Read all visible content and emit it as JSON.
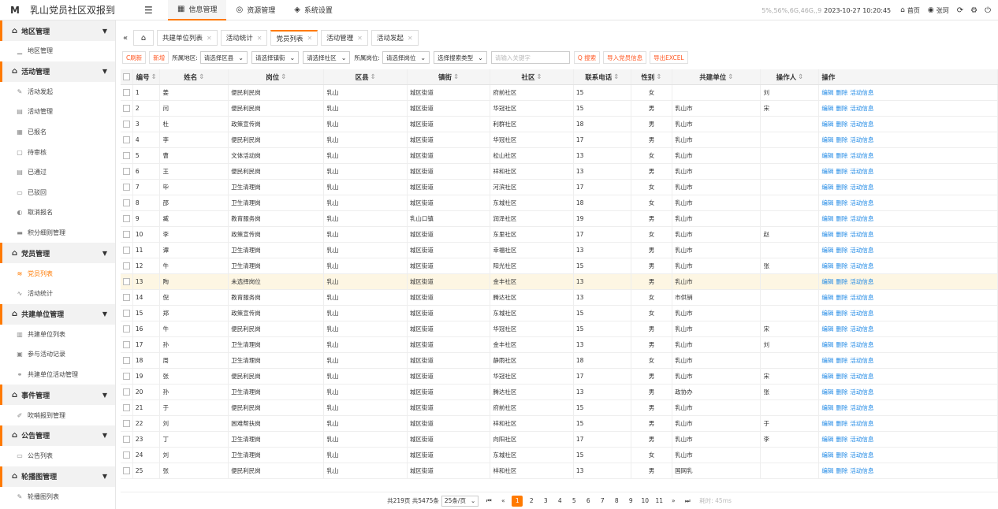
{
  "app": {
    "logo": "M",
    "title": "乳山党员社区双报到",
    "burger": "☰"
  },
  "topnav": [
    {
      "icon": "▦",
      "label": "信息管理",
      "active": true
    },
    {
      "icon": "◎",
      "label": "资源管理",
      "active": false
    },
    {
      "icon": "◈",
      "label": "系统设置",
      "active": false
    }
  ],
  "topright": {
    "stats": "5%,56%,6G,46G,,9",
    "datetime": "2023-10-27 10:20:45",
    "home": "首页",
    "user": "张珂"
  },
  "sidebar": [
    {
      "type": "group",
      "label": "地区管理",
      "icon": "⌂"
    },
    {
      "type": "item",
      "label": "地区管理",
      "icon": "▁"
    },
    {
      "type": "group",
      "label": "活动管理",
      "icon": "⌂"
    },
    {
      "type": "item",
      "label": "活动发起",
      "icon": "✎"
    },
    {
      "type": "item",
      "label": "活动管理",
      "icon": "▤"
    },
    {
      "type": "item",
      "label": "已报名",
      "icon": "▦"
    },
    {
      "type": "item",
      "label": "待审核",
      "icon": "▢"
    },
    {
      "type": "item",
      "label": "已通过",
      "icon": "▤"
    },
    {
      "type": "item",
      "label": "已驳回",
      "icon": "▭"
    },
    {
      "type": "item",
      "label": "取消报名",
      "icon": "◐"
    },
    {
      "type": "item",
      "label": "积分细则管理",
      "icon": "▬"
    },
    {
      "type": "group",
      "label": "党员管理",
      "icon": "⌂"
    },
    {
      "type": "item",
      "label": "党员列表",
      "icon": "≋",
      "active": true
    },
    {
      "type": "item",
      "label": "活动统计",
      "icon": "∿"
    },
    {
      "type": "group",
      "label": "共建单位管理",
      "icon": "⌂"
    },
    {
      "type": "item",
      "label": "共建单位列表",
      "icon": "▥"
    },
    {
      "type": "item",
      "label": "参与活动记录",
      "icon": "▣"
    },
    {
      "type": "item",
      "label": "共建单位活动管理",
      "icon": "⚭"
    },
    {
      "type": "group",
      "label": "事件管理",
      "icon": "⌂"
    },
    {
      "type": "item",
      "label": "吹哨报到管理",
      "icon": "✐"
    },
    {
      "type": "group",
      "label": "公告管理",
      "icon": "⌂"
    },
    {
      "type": "item",
      "label": "公告列表",
      "icon": "▭"
    },
    {
      "type": "group",
      "label": "轮播图管理",
      "icon": "⌂"
    },
    {
      "type": "item",
      "label": "轮播图列表",
      "icon": "✎"
    }
  ],
  "tabs": [
    {
      "label": "共建单位列表",
      "active": false
    },
    {
      "label": "活动统计",
      "active": false
    },
    {
      "label": "党员列表",
      "active": true
    },
    {
      "label": "活动管理",
      "active": false
    },
    {
      "label": "活动发起",
      "active": false
    }
  ],
  "toolbar": {
    "refresh": "C刷新",
    "add": "新增",
    "area_label": "所属地区:",
    "district_select": "请选择区县",
    "street_select": "请选择镇街",
    "community_select": "请选择社区",
    "post_label": "所属岗位:",
    "post_select": "请选择岗位",
    "search_type": "选择搜索类型",
    "keyword_placeholder": "请输入关键字",
    "search": "Q 搜索",
    "import": "导入党员信息",
    "export": "导出EXCEL"
  },
  "table": {
    "headers": {
      "no": "编号",
      "name": "姓名",
      "post": "岗位",
      "district": "区县",
      "street": "镇街",
      "community": "社区",
      "phone": "联系电话",
      "sex": "性别",
      "unit": "共建单位",
      "operator": "操作人",
      "action": "操作"
    },
    "actions": [
      "编辑",
      "删除",
      "活动信息"
    ],
    "rows": [
      {
        "no": "1",
        "name": "姜",
        "post": "便民利民岗",
        "district": "乳山",
        "street": "城区街道",
        "community": "府前社区",
        "phone": "15",
        "sex": "女",
        "unit": "",
        "operator": "刘"
      },
      {
        "no": "2",
        "name": "闫",
        "post": "便民利民岗",
        "district": "乳山",
        "street": "城区街道",
        "community": "华冠社区",
        "phone": "15",
        "sex": "男",
        "unit": "乳山市",
        "operator": "宋"
      },
      {
        "no": "3",
        "name": "杜",
        "post": "政策宣传岗",
        "district": "乳山",
        "street": "城区街道",
        "community": "利群社区",
        "phone": "18",
        "sex": "男",
        "unit": "乳山市",
        "operator": ""
      },
      {
        "no": "4",
        "name": "李",
        "post": "便民利民岗",
        "district": "乳山",
        "street": "城区街道",
        "community": "华冠社区",
        "phone": "17",
        "sex": "男",
        "unit": "乳山市",
        "operator": ""
      },
      {
        "no": "5",
        "name": "曹",
        "post": "文体活动岗",
        "district": "乳山",
        "street": "城区街道",
        "community": "松山社区",
        "phone": "13",
        "sex": "女",
        "unit": "乳山市",
        "operator": ""
      },
      {
        "no": "6",
        "name": "王",
        "post": "便民利民岗",
        "district": "乳山",
        "street": "城区街道",
        "community": "祥和社区",
        "phone": "13",
        "sex": "男",
        "unit": "乳山市",
        "operator": ""
      },
      {
        "no": "7",
        "name": "毕",
        "post": "卫生清理岗",
        "district": "乳山",
        "street": "城区街道",
        "community": "河滨社区",
        "phone": "17",
        "sex": "女",
        "unit": "乳山市",
        "operator": ""
      },
      {
        "no": "8",
        "name": "邵",
        "post": "卫生清理岗",
        "district": "乳山",
        "street": "城区街道",
        "community": "东城社区",
        "phone": "18",
        "sex": "女",
        "unit": "乳山市",
        "operator": ""
      },
      {
        "no": "9",
        "name": "臧",
        "post": "教育服务岗",
        "district": "乳山",
        "street": "乳山口镇",
        "community": "润泽社区",
        "phone": "19",
        "sex": "男",
        "unit": "乳山市",
        "operator": ""
      },
      {
        "no": "10",
        "name": "李",
        "post": "政策宣传岗",
        "district": "乳山",
        "street": "城区街道",
        "community": "东里社区",
        "phone": "17",
        "sex": "女",
        "unit": "乳山市",
        "operator": "赵"
      },
      {
        "no": "11",
        "name": "谭",
        "post": "卫生清理岗",
        "district": "乳山",
        "street": "城区街道",
        "community": "幸福社区",
        "phone": "13",
        "sex": "男",
        "unit": "乳山市",
        "operator": ""
      },
      {
        "no": "12",
        "name": "牛",
        "post": "卫生清理岗",
        "district": "乳山",
        "street": "城区街道",
        "community": "阳光社区",
        "phone": "15",
        "sex": "男",
        "unit": "乳山市",
        "operator": "张"
      },
      {
        "no": "13",
        "name": "陶",
        "post": "未选择岗位",
        "district": "乳山",
        "street": "城区街道",
        "community": "金丰社区",
        "phone": "13",
        "sex": "男",
        "unit": "乳山市",
        "operator": "",
        "hl": true
      },
      {
        "no": "14",
        "name": "倪",
        "post": "教育服务岗",
        "district": "乳山",
        "street": "城区街道",
        "community": "腾达社区",
        "phone": "13",
        "sex": "女",
        "unit": "市供销",
        "operator": ""
      },
      {
        "no": "15",
        "name": "郑",
        "post": "政策宣传岗",
        "district": "乳山",
        "street": "城区街道",
        "community": "东城社区",
        "phone": "15",
        "sex": "女",
        "unit": "乳山市",
        "operator": ""
      },
      {
        "no": "16",
        "name": "牛",
        "post": "便民利民岗",
        "district": "乳山",
        "street": "城区街道",
        "community": "华冠社区",
        "phone": "15",
        "sex": "男",
        "unit": "乳山市",
        "operator": "宋"
      },
      {
        "no": "17",
        "name": "孙",
        "post": "卫生清理岗",
        "district": "乳山",
        "street": "城区街道",
        "community": "金丰社区",
        "phone": "13",
        "sex": "男",
        "unit": "乳山市",
        "operator": "刘"
      },
      {
        "no": "18",
        "name": "周",
        "post": "卫生清理岗",
        "district": "乳山",
        "street": "城区街道",
        "community": "静雨社区",
        "phone": "18",
        "sex": "女",
        "unit": "乳山市",
        "operator": ""
      },
      {
        "no": "19",
        "name": "张",
        "post": "便民利民岗",
        "district": "乳山",
        "street": "城区街道",
        "community": "华冠社区",
        "phone": "17",
        "sex": "男",
        "unit": "乳山市",
        "operator": "宋"
      },
      {
        "no": "20",
        "name": "孙",
        "post": "卫生清理岗",
        "district": "乳山",
        "street": "城区街道",
        "community": "腾达社区",
        "phone": "13",
        "sex": "男",
        "unit": "政协办",
        "operator": "张"
      },
      {
        "no": "21",
        "name": "于",
        "post": "便民利民岗",
        "district": "乳山",
        "street": "城区街道",
        "community": "府前社区",
        "phone": "15",
        "sex": "男",
        "unit": "乳山市",
        "operator": ""
      },
      {
        "no": "22",
        "name": "刘",
        "post": "困难帮扶岗",
        "district": "乳山",
        "street": "城区街道",
        "community": "祥和社区",
        "phone": "15",
        "sex": "男",
        "unit": "乳山市",
        "operator": "于"
      },
      {
        "no": "23",
        "name": "丁",
        "post": "卫生清理岗",
        "district": "乳山",
        "street": "城区街道",
        "community": "向阳社区",
        "phone": "17",
        "sex": "男",
        "unit": "乳山市",
        "operator": "李"
      },
      {
        "no": "24",
        "name": "刘",
        "post": "卫生清理岗",
        "district": "乳山",
        "street": "城区街道",
        "community": "东城社区",
        "phone": "15",
        "sex": "女",
        "unit": "乳山市",
        "operator": ""
      },
      {
        "no": "25",
        "name": "张",
        "post": "便民利民岗",
        "district": "乳山",
        "street": "城区街道",
        "community": "祥和社区",
        "phone": "13",
        "sex": "男",
        "unit": "国网乳",
        "operator": ""
      }
    ]
  },
  "pagination": {
    "summary": "共219页 共5475条",
    "per_page": "25条/页",
    "pages": [
      "1",
      "2",
      "3",
      "4",
      "5",
      "6",
      "7",
      "8",
      "9",
      "10",
      "11"
    ],
    "current": "1",
    "elapsed": "耗时: 45ms"
  },
  "colors": {
    "accent": "#ff7a00",
    "link": "#1e88e5"
  }
}
